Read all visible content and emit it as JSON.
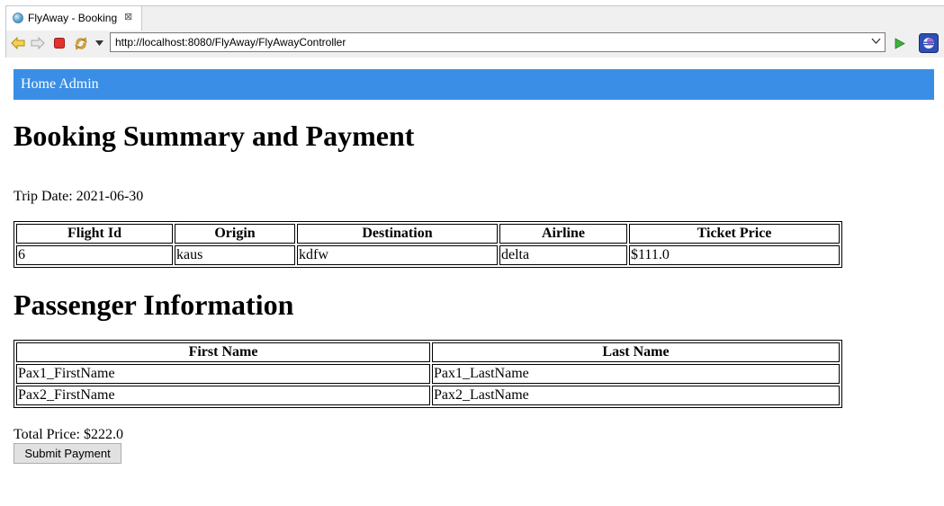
{
  "browser": {
    "tab_title": "FlyAway - Booking",
    "tab_close": "⊠",
    "url": "http://localhost:8080/FlyAway/FlyAwayController",
    "icons": [
      "back-icon",
      "forward-icon",
      "stop-icon",
      "refresh-icon",
      "chevron-down-icon",
      "go-icon",
      "eclipse-icon"
    ]
  },
  "navbar": {
    "links": "Home Admin",
    "color": "#3a8ee6"
  },
  "summary": {
    "heading": "Booking Summary and Payment",
    "trip_date": "Trip Date: 2021-06-30"
  },
  "flight_table": {
    "headers": [
      "Flight Id",
      "Origin",
      "Destination",
      "Airline",
      "Ticket Price"
    ],
    "rows": [
      [
        "6",
        "kaus",
        "kdfw",
        "delta",
        "$111.0"
      ]
    ]
  },
  "passenger": {
    "heading": "Passenger Information",
    "headers": [
      "First Name",
      "Last Name"
    ],
    "rows": [
      [
        "Pax1_FirstName",
        "Pax1_LastName"
      ],
      [
        "Pax2_FirstName",
        "Pax2_LastName"
      ]
    ]
  },
  "total_price": "Total Price: $222.0",
  "submit_label": "Submit Payment"
}
